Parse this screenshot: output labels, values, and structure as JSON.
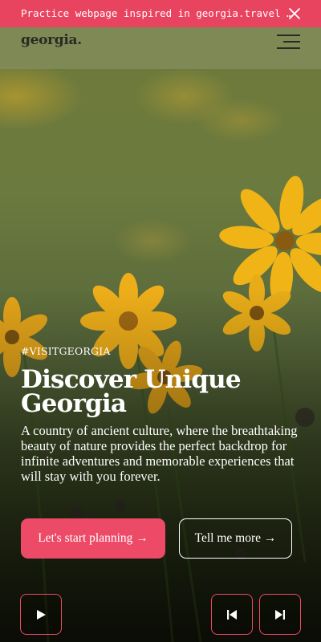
{
  "banner": {
    "text": "Practice webpage inspired in georgia.travel …",
    "close_icon": "close-icon"
  },
  "header": {
    "logo": "georgia.",
    "menu_icon": "hamburger-menu-icon"
  },
  "hero": {
    "tag": "#VISITGEORGIA",
    "title": "Discover Unique Georgia",
    "description": "A country of ancient culture, where the breathtaking beauty of nature provides the perfect backdrop for infinite adventures and memorable experiences that will stay with you forever.",
    "primary_button": "Let's start planning →",
    "secondary_button": "Tell me more →"
  },
  "controls": {
    "play_icon": "play-icon",
    "previous_icon": "skip-previous-icon",
    "next_icon": "skip-next-icon"
  },
  "colors": {
    "accent": "#ec4a67",
    "banner": "#e8435f",
    "text_dark": "#2a2a22"
  }
}
